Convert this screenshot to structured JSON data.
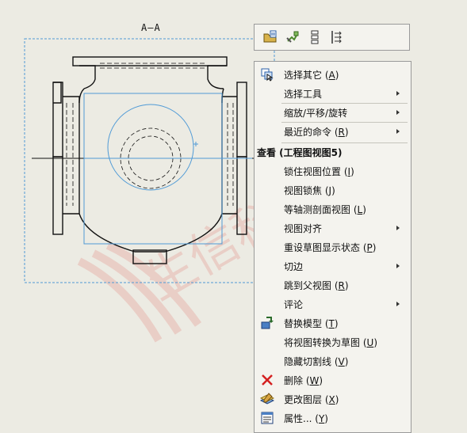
{
  "section_label": "A—A",
  "watermark": "生信科技",
  "toolbar": {
    "buttons": [
      {
        "name": "open-drawing-button",
        "icon": "folder-open-icon"
      },
      {
        "name": "move-view-button",
        "icon": "move-hand-icon"
      },
      {
        "name": "layout-button",
        "icon": "stack-icon"
      },
      {
        "name": "align-button",
        "icon": "align-arrows-icon"
      }
    ]
  },
  "menu": {
    "header": "查看 (工程图视图5)",
    "top_items": [
      {
        "label": "选择其它",
        "key": "A",
        "icon": "select-other-icon",
        "submenu": false
      },
      {
        "label": "选择工具",
        "key": "",
        "icon": "",
        "submenu": true
      },
      {
        "label": "缩放/平移/旋转",
        "key": "",
        "icon": "",
        "submenu": true
      },
      {
        "label": "最近的命令",
        "key": "R",
        "icon": "",
        "submenu": true
      }
    ],
    "view_items": [
      {
        "label": "锁住视图位置",
        "key": "I",
        "icon": "",
        "submenu": false
      },
      {
        "label": "视图锁焦",
        "key": "J",
        "icon": "",
        "submenu": false
      },
      {
        "label": "等轴测剖面视图",
        "key": "L",
        "icon": "",
        "submenu": false
      },
      {
        "label": "视图对齐",
        "key": "",
        "icon": "",
        "submenu": true
      },
      {
        "label": "重设草图显示状态",
        "key": "P",
        "icon": "",
        "submenu": false
      },
      {
        "label": "切边",
        "key": "",
        "icon": "",
        "submenu": true
      },
      {
        "label": "跳到父视图",
        "key": "R",
        "icon": "",
        "submenu": false
      },
      {
        "label": "评论",
        "key": "",
        "icon": "",
        "submenu": true
      },
      {
        "label": "替换模型",
        "key": "T",
        "icon": "replace-model-icon",
        "submenu": false
      },
      {
        "label": "将视图转换为草图",
        "key": "U",
        "icon": "",
        "submenu": false
      },
      {
        "label": "隐藏切割线",
        "key": "V",
        "icon": "",
        "submenu": false
      },
      {
        "label": "删除",
        "key": "W",
        "icon": "delete-x-icon",
        "submenu": false
      },
      {
        "label": "更改图层",
        "key": "X",
        "icon": "change-layer-icon",
        "submenu": false
      },
      {
        "label": "属性...",
        "key": "Y",
        "icon": "properties-icon",
        "submenu": false
      }
    ]
  },
  "colors": {
    "background": "#ecebe3",
    "view_boundary": "#4f9ad6",
    "drawing_line": "#111111",
    "delete_icon": "#d42020",
    "watermark": "#e8b8b0"
  }
}
